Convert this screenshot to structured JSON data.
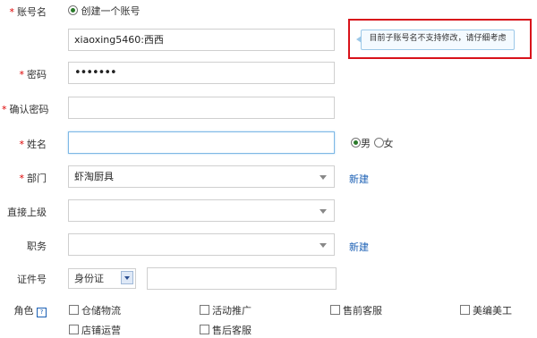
{
  "form": {
    "account_label": "账号名",
    "create_account_label": "创建一个账号",
    "account_value": "xiaoxing5460:西西",
    "account_tip": "目前子账号名不支持修改，请仔细考虑",
    "password_label": "密码",
    "password_value": "•••••••",
    "confirm_password_label": "确认密码",
    "confirm_password_value": "",
    "name_label": "姓名",
    "name_value": "",
    "gender_male_label": "男",
    "gender_female_label": "女",
    "gender_selected": "男",
    "department_label": "部门",
    "department_value": "虾淘厨具",
    "new_department_label": "新建",
    "supervisor_label": "直接上级",
    "supervisor_value": "",
    "position_label": "职务",
    "position_value": "",
    "new_position_label": "新建",
    "id_label": "证件号",
    "id_type_value": "身份证",
    "id_number_value": "",
    "role_label": "角色",
    "role_help_icon": "?",
    "roles": [
      "仓储物流",
      "活动推广",
      "售前客服",
      "美编美工",
      "店铺运营",
      "售后客服"
    ]
  },
  "colors": {
    "required_star": "#dd0000",
    "tip_border": "#d8121a",
    "link": "#1a5fb4"
  }
}
